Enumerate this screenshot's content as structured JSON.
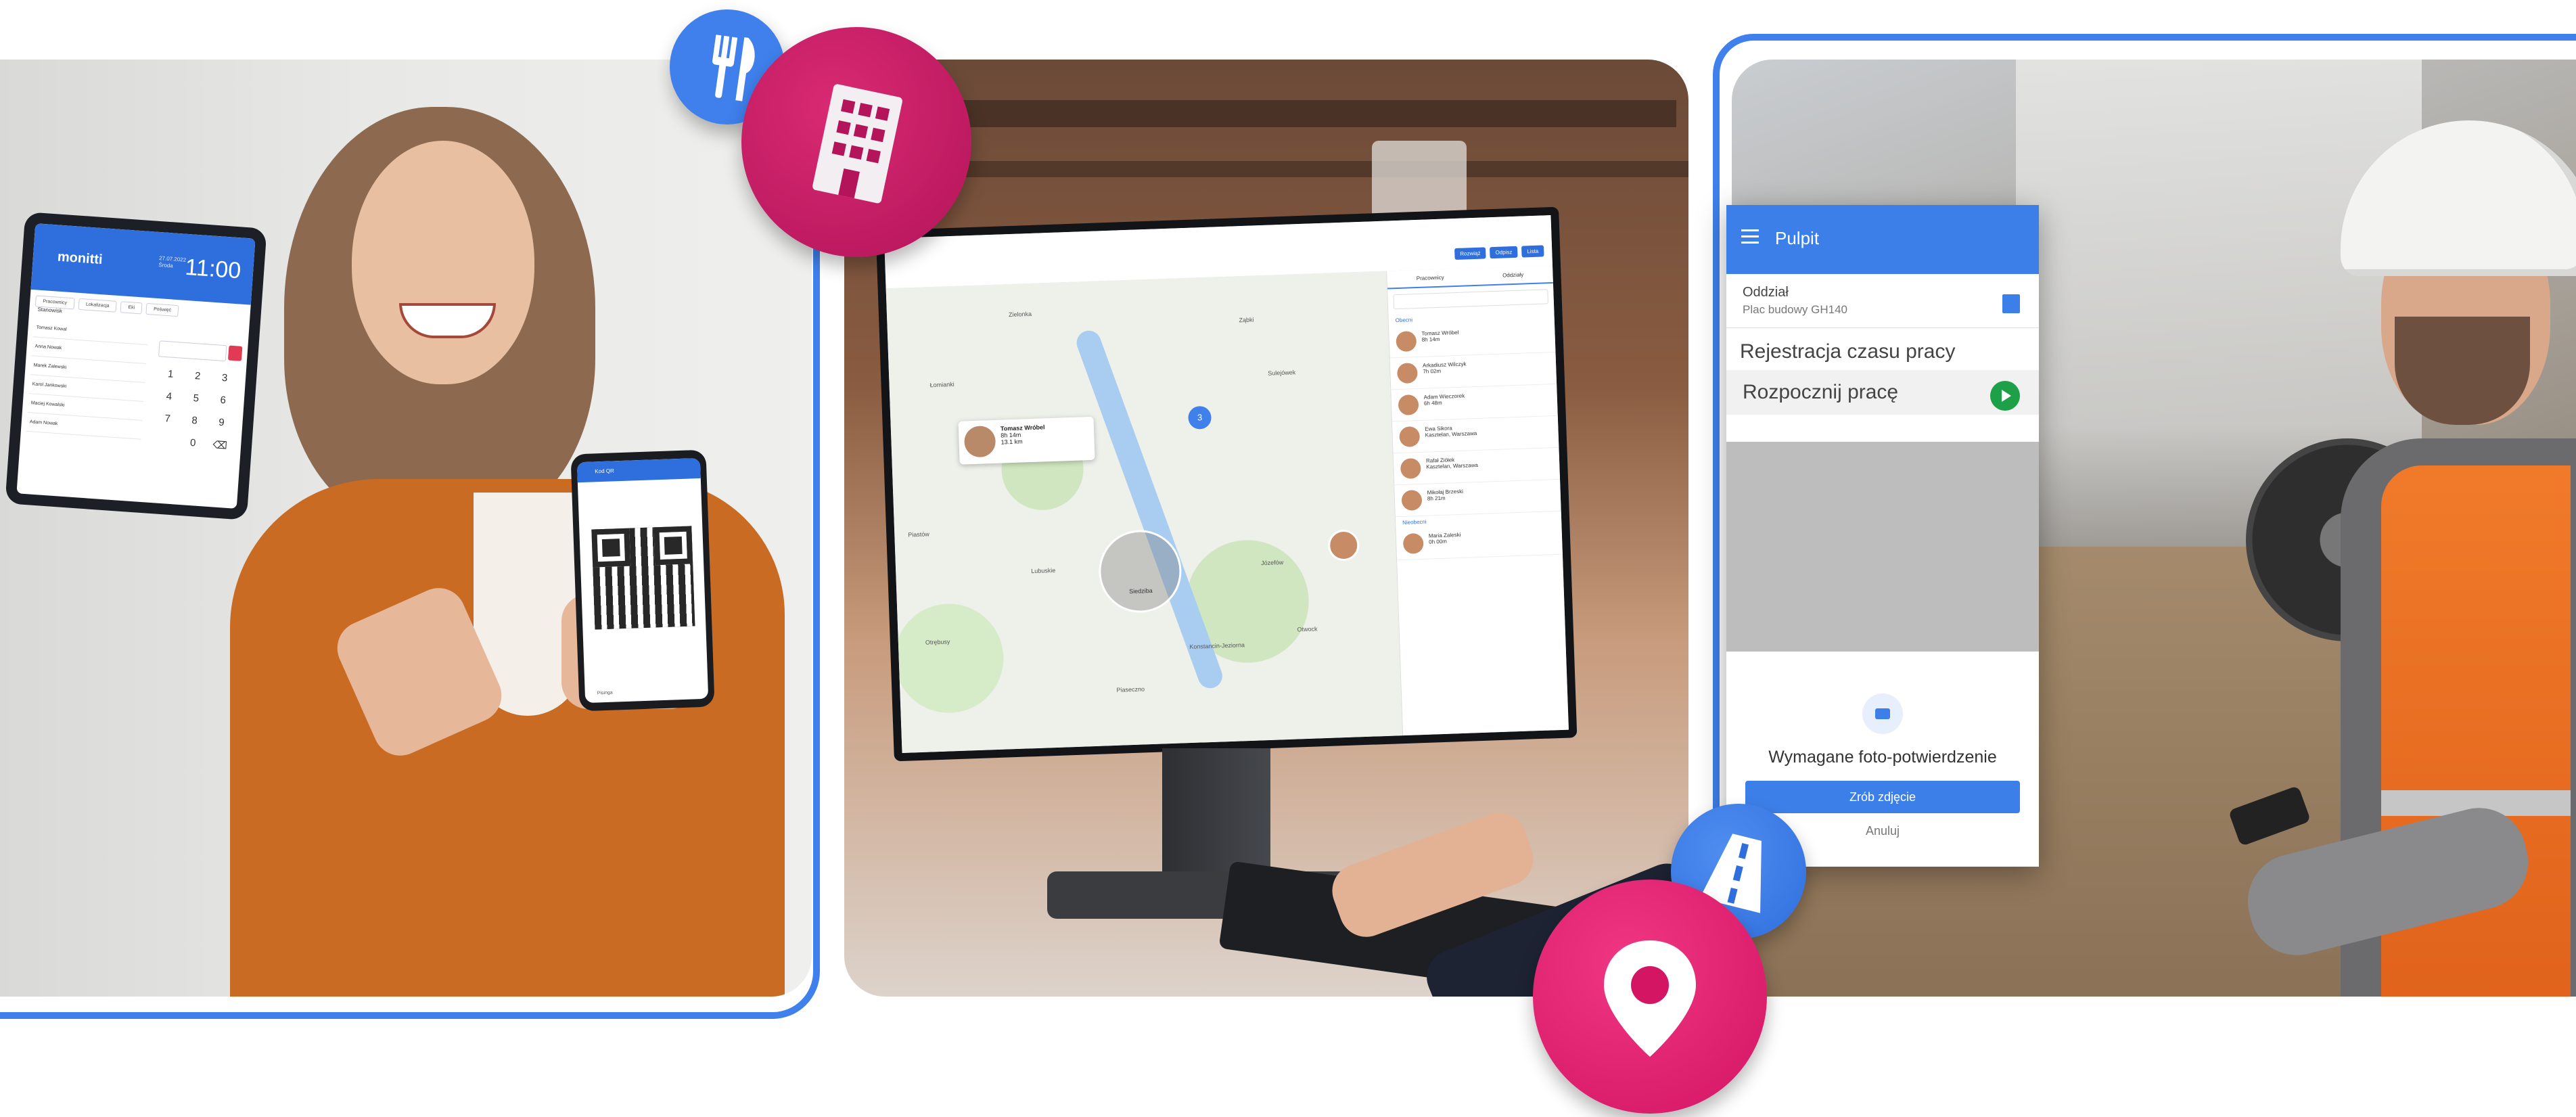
{
  "left_panel": {
    "tablet": {
      "logo": "monitti",
      "time": "11:00",
      "date_lines": [
        "27.07.2022",
        "Środa"
      ],
      "tabs": [
        "Pracownicy",
        "Lokalizacja",
        "Eki",
        "Poświęć"
      ],
      "list_header": "Stanowisk",
      "list_items": [
        "Tomasz Kowal",
        "Anna Nowak",
        "Marek Zalewski",
        "Karol Jankowski",
        "Maciej Kowalski",
        "Adam Nowak"
      ],
      "keypad": [
        "1",
        "2",
        "3",
        "4",
        "5",
        "6",
        "7",
        "8",
        "9",
        "",
        "0",
        "⌫"
      ]
    },
    "phone": {
      "header": "Kod QR",
      "tag": "Pisinga"
    }
  },
  "middle_panel": {
    "toolbar_buttons": [
      "Rozwiąż",
      "Odpisz",
      "Lista"
    ],
    "map_labels": [
      "Zielonka",
      "Ząbki",
      "Sulejówek",
      "Łomianki",
      "Piastów",
      "Lubuskie",
      "Otrębusy",
      "Józefów",
      "Otwock",
      "Piaseczno",
      "Konstancin-Jeziorna"
    ],
    "cluster_count": "3",
    "pin_card": {
      "name": "Tomasz Wróbel",
      "line1": "8h 14m",
      "line2": "13.1 km"
    },
    "venue_label": "Siedziba",
    "side_tabs": [
      "Pracownicy",
      "Oddziały"
    ],
    "side_group": "Obecni",
    "side_group_2": "Nieobecni",
    "workers": [
      {
        "name": "Tomasz Wróbel",
        "meta": "8h 14m"
      },
      {
        "name": "Arkadiusz Wilczyk",
        "meta": "7h 02m"
      },
      {
        "name": "Adam Wieczorek",
        "meta": "6h 48m"
      },
      {
        "name": "Ewa Sikora",
        "meta": "Kasztelan, Warszawa"
      },
      {
        "name": "Rafał Ziółek",
        "meta": "Kasztelan, Warszawa"
      },
      {
        "name": "Mikołaj Brzeski",
        "meta": "8h 21m"
      },
      {
        "name": "Maria Zaleski",
        "meta": "0h 00m"
      }
    ]
  },
  "right_panel": {
    "app": {
      "title": "Pulpit",
      "branch_label": "Oddział",
      "branch_value": "Plac budowy GH140",
      "section_title": "Rejestracja czasu pracy",
      "start_label": "Rozpocznij pracę",
      "sheet_title": "Wymagane foto-potwierdzenie",
      "take_photo_button": "Zrób zdjęcie",
      "cancel_button": "Anuluj"
    }
  },
  "badges": {
    "restaurant": {
      "icon": "fork-knife-icon",
      "color": "#3f80ec"
    },
    "office": {
      "icon": "building-icon",
      "color": "#c91b63"
    },
    "road": {
      "icon": "road-icon",
      "color": "#3f80ec"
    },
    "location": {
      "icon": "location-pin-icon",
      "color": "#e91f72"
    }
  },
  "colors": {
    "brand_blue": "#3f80ec",
    "accent_pink": "#e91f72",
    "accent_magenta": "#c91b63",
    "start_green": "#1ea048"
  }
}
